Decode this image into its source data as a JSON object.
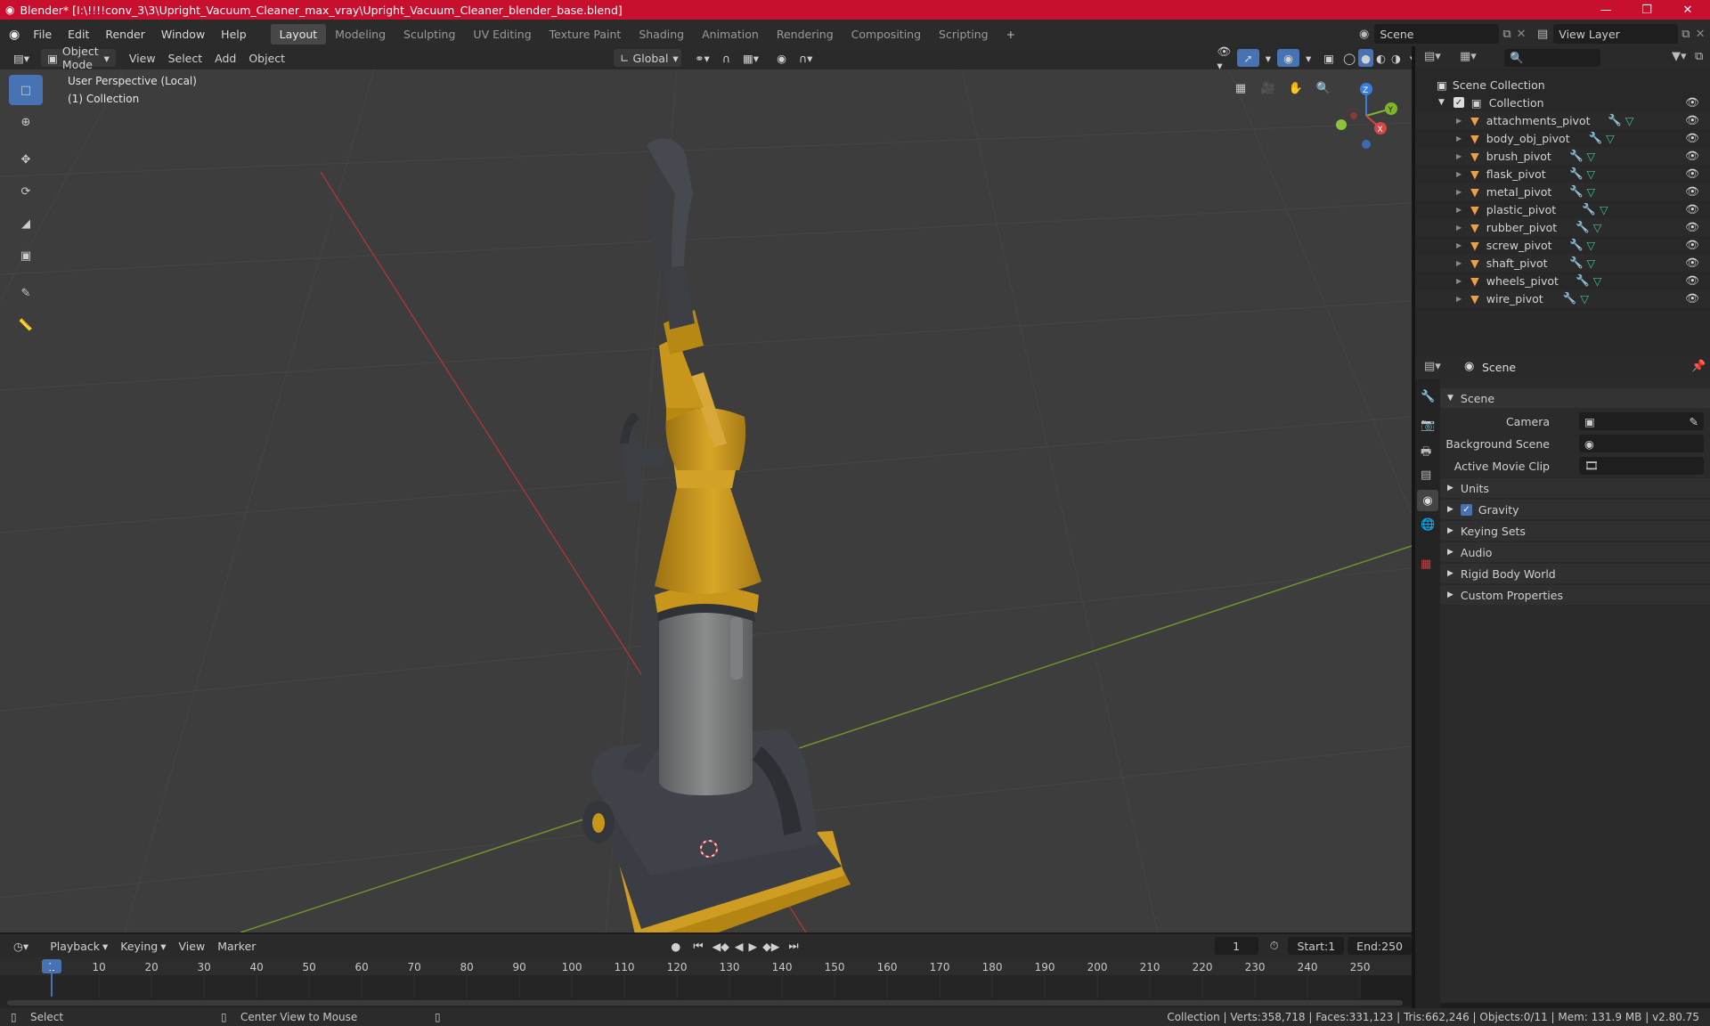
{
  "window": {
    "title": "Blender* [I:\\!!!!conv_3\\3\\Upright_Vacuum_Cleaner_max_vray\\Upright_Vacuum_Cleaner_blender_base.blend]",
    "controls": {
      "minimize": "—",
      "maximize": "❐",
      "close": "✕"
    }
  },
  "menubar": {
    "items": [
      "File",
      "Edit",
      "Render",
      "Window",
      "Help"
    ],
    "workspaces": [
      "Layout",
      "Modeling",
      "Sculpting",
      "UV Editing",
      "Texture Paint",
      "Shading",
      "Animation",
      "Rendering",
      "Compositing",
      "Scripting"
    ],
    "active_workspace": "Layout",
    "add_workspace": "+",
    "scene": "Scene",
    "view_layer": "View Layer"
  },
  "viewport_header": {
    "mode": "Object Mode",
    "menus": [
      "View",
      "Select",
      "Add",
      "Object"
    ],
    "transform_orientation": "Global"
  },
  "viewport": {
    "info_line1": "User Perspective (Local)",
    "info_line2": "(1) Collection",
    "gizmo_axes": {
      "z": "Z",
      "y": "Y",
      "x": "X"
    }
  },
  "outliner": {
    "root": "Scene Collection",
    "collection": "Collection",
    "items": [
      "attachments_pivot",
      "body_obj_pivot",
      "brush_pivot",
      "flask_pivot",
      "metal_pivot",
      "plastic_pivot",
      "rubber_pivot",
      "screw_pivot",
      "shaft_pivot",
      "wheels_pivot",
      "wire_pivot"
    ]
  },
  "properties": {
    "context": "Scene",
    "panel": "Scene",
    "fields": [
      {
        "label": "Camera",
        "value": ""
      },
      {
        "label": "Background Scene",
        "value": ""
      },
      {
        "label": "Active Movie Clip",
        "value": ""
      }
    ],
    "sections": [
      "Units",
      "Gravity",
      "Keying Sets",
      "Audio",
      "Rigid Body World",
      "Custom Properties"
    ],
    "gravity_checked": true
  },
  "timeline": {
    "menus": [
      "Playback",
      "Keying",
      "View",
      "Marker"
    ],
    "current_frame": "1",
    "start_label": "Start:",
    "start": "1",
    "end_label": "End:",
    "end": "250",
    "ticks": [
      "1",
      "10",
      "20",
      "30",
      "40",
      "50",
      "60",
      "70",
      "80",
      "90",
      "100",
      "110",
      "120",
      "130",
      "140",
      "150",
      "160",
      "170",
      "180",
      "190",
      "200",
      "210",
      "220",
      "230",
      "240",
      "250"
    ]
  },
  "statusbar": {
    "left_action": "Select",
    "middle_action": "Center View to Mouse",
    "stats": "Collection | Verts:358,718 | Faces:331,123 | Tris:662,246 | Objects:0/11 | Mem: 131.9 MB | v2.80.75"
  },
  "colors": {
    "title_bar": "#c8102e",
    "accent": "#4772b3",
    "object_icon": "#e8a04a",
    "mesh_icon": "#3fbfa0",
    "modifier_icon": "#6ca0e0",
    "vacuum_yellow": "#c8961b",
    "vacuum_dark": "#3b3e44",
    "x_axis": "#c04040",
    "y_axis": "#7aa02a"
  }
}
